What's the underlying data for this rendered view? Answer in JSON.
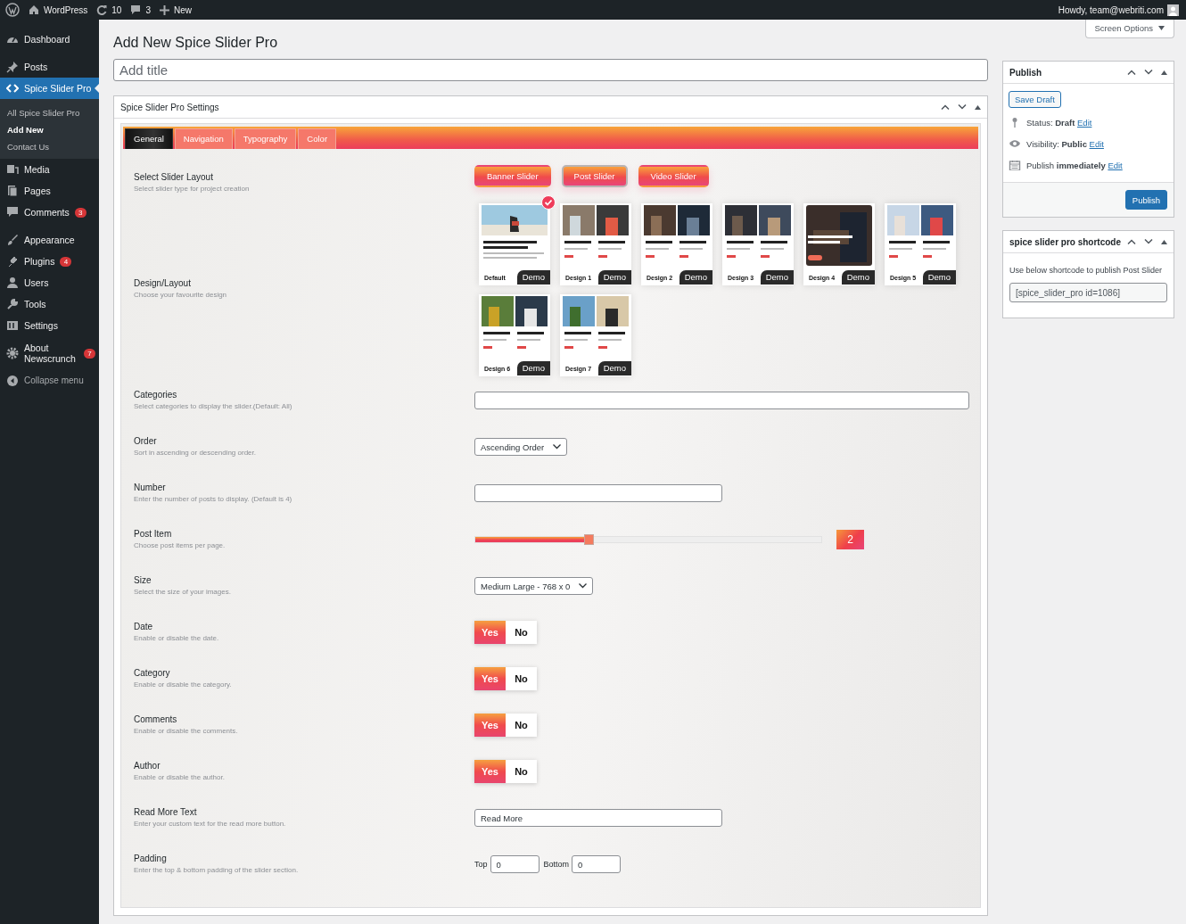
{
  "admin_bar": {
    "site": "WordPress",
    "updates": "10",
    "comments": "3",
    "new": "New",
    "greeting": "Howdy, team@webriti.com"
  },
  "sidebar": {
    "groups": [
      [
        {
          "label": "Dashboard",
          "selected": false
        }
      ],
      [
        {
          "label": "Posts",
          "selected": false
        },
        {
          "label": "Spice Slider Pro",
          "selected": true,
          "children": [
            {
              "label": "All Spice Slider Pro",
              "selected": false
            },
            {
              "label": "Add New",
              "selected": true
            },
            {
              "label": "Contact Us",
              "selected": false
            }
          ]
        },
        {
          "label": "Media",
          "selected": false
        },
        {
          "label": "Pages",
          "selected": false
        },
        {
          "label": "Comments",
          "selected": false,
          "badge": "3"
        }
      ],
      [
        {
          "label": "Appearance",
          "selected": false
        },
        {
          "label": "Plugins",
          "selected": false,
          "badge": "4"
        },
        {
          "label": "Users",
          "selected": false
        },
        {
          "label": "Tools",
          "selected": false
        },
        {
          "label": "Settings",
          "selected": false
        }
      ],
      [
        {
          "label": "About Newscrunch",
          "selected": false,
          "badge": "7"
        }
      ]
    ],
    "collapse": "Collapse menu"
  },
  "screen_options": "Screen Options",
  "page_title": "Add New Spice Slider Pro",
  "title_field": {
    "placeholder": "Add title"
  },
  "settings": {
    "title": "Spice Slider Pro Settings",
    "tabs": [
      {
        "label": "General",
        "selected": true
      },
      {
        "label": "Navigation",
        "selected": false
      },
      {
        "label": "Typography",
        "selected": false
      },
      {
        "label": "Color",
        "selected": false
      }
    ],
    "rows": [
      {
        "kind": "buttons",
        "label": "Select Slider Layout",
        "description": "Select slider type for project creation",
        "options": [
          {
            "label": "Banner Slider",
            "selected": false
          },
          {
            "label": "Post Slider",
            "selected": true
          },
          {
            "label": "Video Slider",
            "selected": false
          }
        ]
      },
      {
        "kind": "designs",
        "label": "Design/Layout",
        "description": "Choose your favourite design",
        "designs": [
          {
            "label": "Default",
            "demo": "Demo",
            "selected": true
          },
          {
            "label": "Design 1",
            "demo": "Demo",
            "selected": false
          },
          {
            "label": "Design 2",
            "demo": "Demo",
            "selected": false
          },
          {
            "label": "Design 3",
            "demo": "Demo",
            "selected": false
          },
          {
            "label": "Design 4",
            "demo": "Demo",
            "selected": false
          },
          {
            "label": "Design 5",
            "demo": "Demo",
            "selected": false
          },
          {
            "label": "Design 6",
            "demo": "Demo",
            "selected": false
          },
          {
            "label": "Design 7",
            "demo": "Demo",
            "selected": false
          }
        ]
      },
      {
        "kind": "wide_text",
        "label": "Categories",
        "description": "Select categories to display the slider.(Default: All)"
      },
      {
        "kind": "select",
        "label": "Order",
        "description": "Sort in ascending or descending order.",
        "value": "Ascending Order"
      },
      {
        "kind": "text",
        "label": "Number",
        "description": "Enter the number of posts to display. (Default is 4)"
      },
      {
        "kind": "slider",
        "label": "Post Item",
        "description": "Choose post items per page.",
        "level": 0.33,
        "reading": "2"
      },
      {
        "kind": "select",
        "label": "Size",
        "description": "Select the size of your images.",
        "value": "Medium Large - 768 x 0"
      },
      {
        "kind": "toggle",
        "label": "Date",
        "description": "Enable or disable the date.",
        "options": [
          {
            "label": "Yes",
            "selected": true
          },
          {
            "label": "No",
            "selected": false
          }
        ]
      },
      {
        "kind": "toggle",
        "label": "Category",
        "description": "Enable or disable the category.",
        "options": [
          {
            "label": "Yes",
            "selected": true
          },
          {
            "label": "No",
            "selected": false
          }
        ]
      },
      {
        "kind": "toggle",
        "label": "Comments",
        "description": "Enable or disable the comments.",
        "options": [
          {
            "label": "Yes",
            "selected": true
          },
          {
            "label": "No",
            "selected": false
          }
        ]
      },
      {
        "kind": "toggle",
        "label": "Author",
        "description": "Enable or disable the author.",
        "options": [
          {
            "label": "Yes",
            "selected": true
          },
          {
            "label": "No",
            "selected": false
          }
        ]
      },
      {
        "kind": "text",
        "label": "Read More Text",
        "description": "Enter your custom text for the read more button.",
        "value": "Read More"
      },
      {
        "kind": "padding",
        "label": "Padding",
        "description": "Enter the top & bottom padding of the slider section.",
        "fields": [
          {
            "label": "Top",
            "value": "0"
          },
          {
            "label": "Bottom",
            "value": "0"
          }
        ]
      }
    ]
  },
  "publish": {
    "title": "Publish",
    "save_draft": "Save Draft",
    "lines": [
      {
        "label": "Status:",
        "value": "Draft",
        "link": "Edit"
      },
      {
        "label": "Visibility:",
        "value": "Public",
        "link": "Edit"
      },
      {
        "label": "Publish",
        "value": "immediately",
        "link": "Edit"
      }
    ],
    "button": "Publish"
  },
  "shortcode": {
    "title": "spice slider pro shortcode",
    "hint": "Use below shortcode to publish Post Slider",
    "value": "[spice_slider_pro id=1086]"
  }
}
